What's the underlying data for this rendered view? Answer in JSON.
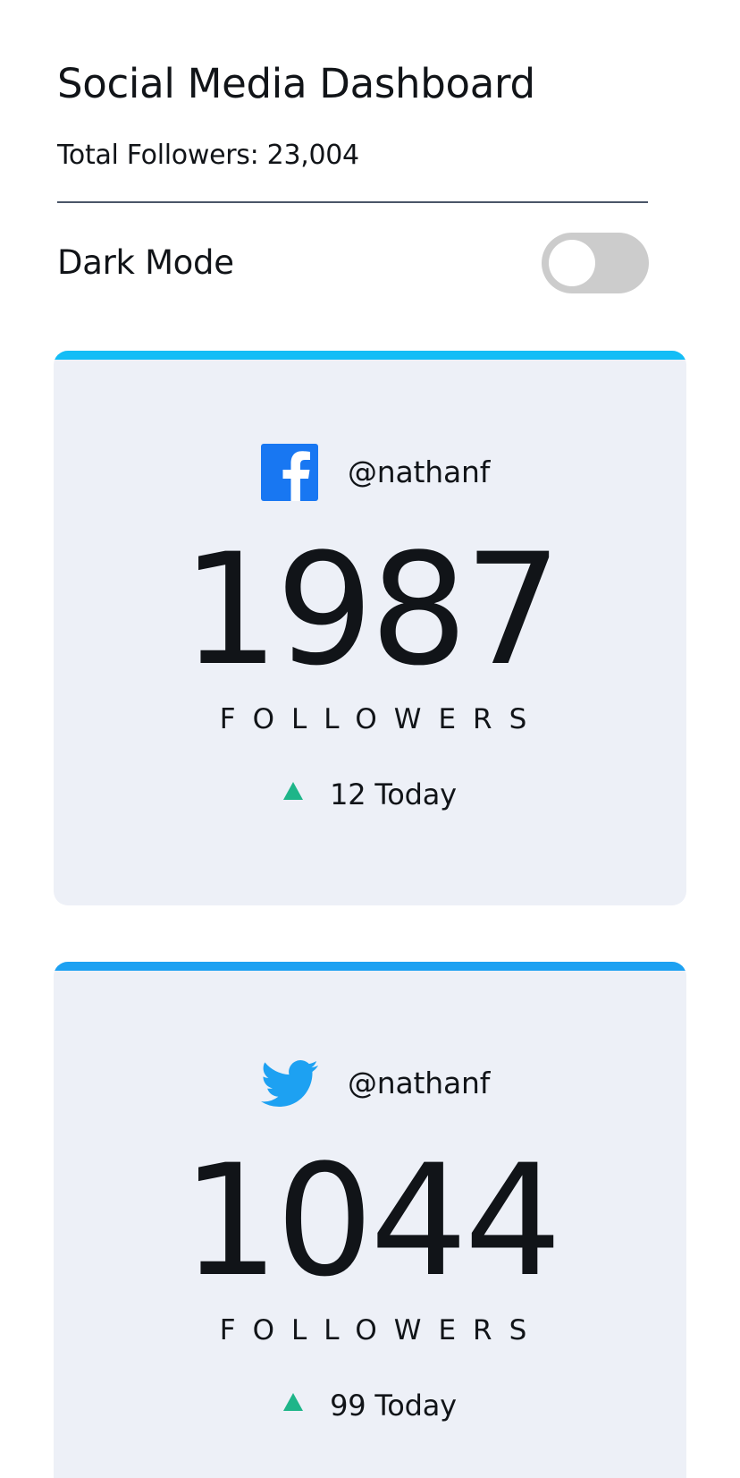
{
  "header": {
    "title": "Social Media Dashboard",
    "total_followers": "Total Followers: 23,004"
  },
  "dark_mode": {
    "label": "Dark Mode",
    "enabled": false
  },
  "cards": [
    {
      "network": "facebook",
      "icon": "facebook-icon",
      "accent_color": "#13bdf6",
      "handle": "@nathanf",
      "count": "1987",
      "label": "FOLLOWERS",
      "today": "12 Today",
      "trend": "up"
    },
    {
      "network": "twitter",
      "icon": "twitter-icon",
      "accent_color": "#1da1f2",
      "handle": "@nathanf",
      "count": "1044",
      "label": "FOLLOWERS",
      "today": "99 Today",
      "trend": "up"
    }
  ],
  "colors": {
    "facebook_blue": "#1877f2",
    "twitter_blue": "#1da1f2",
    "trend_up": "#1eb589",
    "card_bg": "#edf0f7",
    "toggle_off": "#cccccc"
  }
}
